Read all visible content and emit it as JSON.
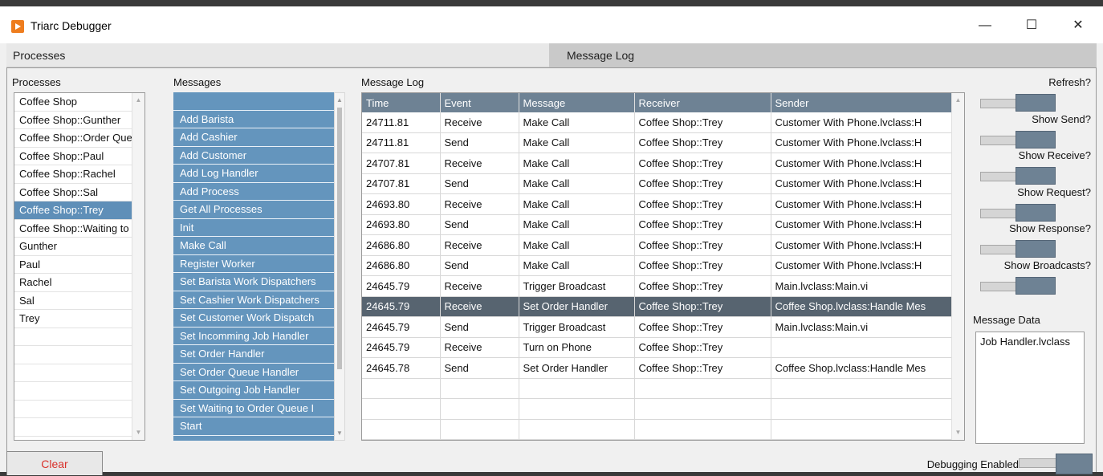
{
  "window": {
    "title": "Triarc Debugger",
    "minimize": "—",
    "maximize": "☐",
    "close": "✕"
  },
  "tabs": {
    "processes": "Processes",
    "message_log": "Message Log"
  },
  "processes": {
    "label": "Processes",
    "items": [
      "Coffee Shop",
      "Coffee Shop::Gunther",
      "Coffee Shop::Order Que",
      "Coffee Shop::Paul",
      "Coffee Shop::Rachel",
      "Coffee Shop::Sal",
      "Coffee Shop::Trey",
      "Coffee Shop::Waiting to",
      "Gunther",
      "Paul",
      "Rachel",
      "Sal",
      "Trey",
      "",
      "",
      "",
      "",
      "",
      ""
    ],
    "selected": "Coffee Shop::Trey"
  },
  "messages": {
    "label": "Messages",
    "items": [
      "",
      "Add Barista",
      "Add Cashier",
      "Add Customer",
      "Add Log Handler",
      "Add Process",
      "Get All Processes",
      "Init",
      "Make Call",
      "Register Worker",
      "Set Barista Work Dispatchers",
      "Set Cashier Work Dispatchers",
      "Set Customer Work Dispatch",
      "Set Incomming Job Handler",
      "Set Order Handler",
      "Set Order Queue Handler",
      "Set Outgoing Job Handler",
      "Set Waiting to Order Queue I",
      "Start"
    ]
  },
  "message_log": {
    "label": "Message Log",
    "columns": [
      "Time",
      "Event",
      "Message",
      "Receiver",
      "Sender"
    ],
    "rows": [
      [
        "24711.81",
        "Receive",
        "Make Call",
        "Coffee Shop::Trey",
        "Customer With Phone.lvclass:H"
      ],
      [
        "24711.81",
        "Send",
        "Make Call",
        "Coffee Shop::Trey",
        "Customer With Phone.lvclass:H"
      ],
      [
        "24707.81",
        "Receive",
        "Make Call",
        "Coffee Shop::Trey",
        "Customer With Phone.lvclass:H"
      ],
      [
        "24707.81",
        "Send",
        "Make Call",
        "Coffee Shop::Trey",
        "Customer With Phone.lvclass:H"
      ],
      [
        "24693.80",
        "Receive",
        "Make Call",
        "Coffee Shop::Trey",
        "Customer With Phone.lvclass:H"
      ],
      [
        "24693.80",
        "Send",
        "Make Call",
        "Coffee Shop::Trey",
        "Customer With Phone.lvclass:H"
      ],
      [
        "24686.80",
        "Receive",
        "Make Call",
        "Coffee Shop::Trey",
        "Customer With Phone.lvclass:H"
      ],
      [
        "24686.80",
        "Send",
        "Make Call",
        "Coffee Shop::Trey",
        "Customer With Phone.lvclass:H"
      ],
      [
        "24645.79",
        "Receive",
        "Trigger Broadcast",
        "Coffee Shop::Trey",
        "Main.lvclass:Main.vi"
      ],
      [
        "24645.79",
        "Receive",
        "Set Order Handler",
        "Coffee Shop::Trey",
        "Coffee Shop.lvclass:Handle Mes"
      ],
      [
        "24645.79",
        "Send",
        "Trigger Broadcast",
        "Coffee Shop::Trey",
        "Main.lvclass:Main.vi"
      ],
      [
        "24645.79",
        "Receive",
        "Turn on Phone",
        "Coffee Shop::Trey",
        ""
      ],
      [
        "24645.78",
        "Send",
        "Set Order Handler",
        "Coffee Shop::Trey",
        "Coffee Shop.lvclass:Handle Mes"
      ],
      [
        "",
        "",
        "",
        "",
        ""
      ],
      [
        "",
        "",
        "",
        "",
        ""
      ],
      [
        "",
        "",
        "",
        "",
        ""
      ],
      [
        "",
        "",
        "",
        "",
        ""
      ],
      [
        "",
        "",
        "",
        "",
        ""
      ]
    ],
    "selected_row": 9
  },
  "toggles": [
    "Refresh?",
    "Show Send?",
    "Show Receive?",
    "Show Request?",
    "Show Response?",
    "Show Broadcasts?"
  ],
  "message_data": {
    "label": "Message Data",
    "value": "Job Handler.lvclass"
  },
  "footer": {
    "clear": "Clear",
    "debugging_enabled": "Debugging Enabled"
  },
  "colors": {
    "accent_blue": "#6495bd",
    "selected_row": "#576470",
    "header": "#6e8294",
    "clear_text": "#d9302a",
    "app_icon": "#ee7d1e"
  }
}
